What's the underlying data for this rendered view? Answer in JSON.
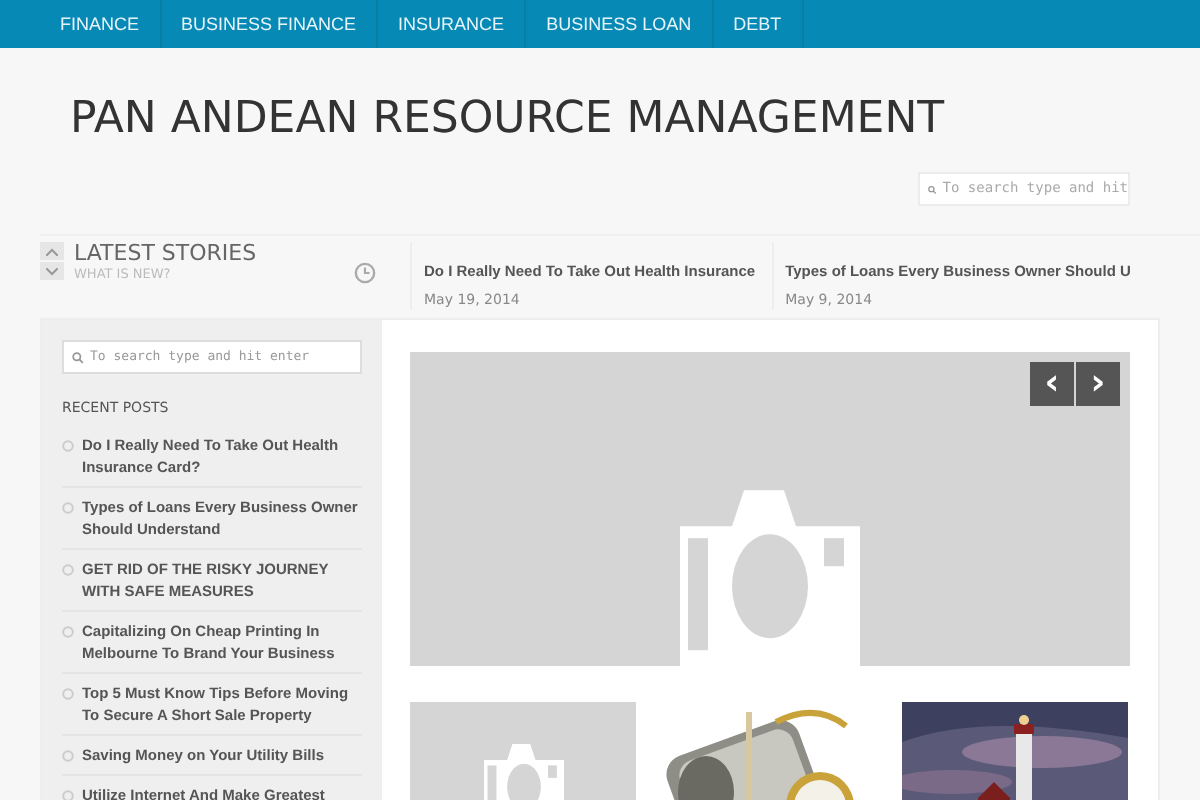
{
  "nav": [
    {
      "label": "FINANCE"
    },
    {
      "label": "BUSINESS FINANCE"
    },
    {
      "label": "INSURANCE"
    },
    {
      "label": "BUSINESS LOAN"
    },
    {
      "label": "DEBT"
    }
  ],
  "site_title": "PAN ANDEAN RESOURCE MANAGEMENT",
  "header_search": {
    "placeholder": "To search type and hit"
  },
  "ticker": {
    "title": "LATEST STORIES",
    "subtitle": "WHAT IS NEW?",
    "items": [
      {
        "title": "Do I Really Need To Take Out Health Insurance",
        "date": "May 19, 2014"
      },
      {
        "title": "Types of Loans Every Business Owner Should U",
        "date": "May 9, 2014"
      }
    ]
  },
  "sidebar": {
    "search": {
      "placeholder": "To search type and hit enter"
    },
    "heading": "RECENT POSTS",
    "posts": [
      {
        "title": "Do I Really Need To Take Out Health Insurance Card?"
      },
      {
        "title": "Types of Loans Every Business Owner Should Understand"
      },
      {
        "title": "GET RID OF THE RISKY JOURNEY WITH SAFE MEASURES"
      },
      {
        "title": "Capitalizing On Cheap Printing In Melbourne To Brand Your Business"
      },
      {
        "title": "Top 5 Must Know Tips Before Moving To Secure A Short Sale Property"
      },
      {
        "title": "Saving Money on Your Utility Bills"
      },
      {
        "title": "Utilize Internet And Make Greatest"
      }
    ]
  },
  "slider": {
    "prev": "‹",
    "next": "›"
  },
  "thumbnails": [
    {
      "kind": "placeholder"
    },
    {
      "kind": "money"
    },
    {
      "kind": "lighthouse"
    }
  ]
}
